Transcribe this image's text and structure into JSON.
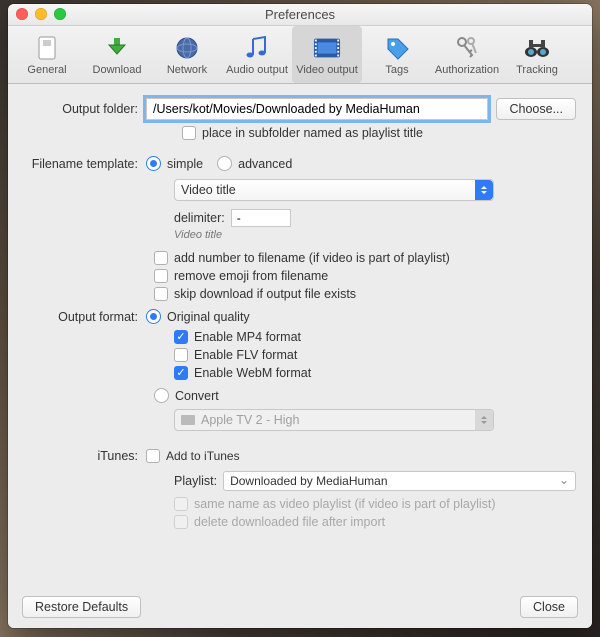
{
  "window": {
    "title": "Preferences"
  },
  "toolbar": {
    "items": [
      {
        "label": "General"
      },
      {
        "label": "Download"
      },
      {
        "label": "Network"
      },
      {
        "label": "Audio output"
      },
      {
        "label": "Video output"
      },
      {
        "label": "Tags"
      },
      {
        "label": "Authorization"
      },
      {
        "label": "Tracking"
      }
    ]
  },
  "labels": {
    "output_folder": "Output folder:",
    "filename_template": "Filename template:",
    "output_format": "Output format:",
    "itunes": "iTunes:",
    "delimiter": "delimiter:",
    "playlist": "Playlist:"
  },
  "values": {
    "output_folder": "/Users/kot/Movies/Downloaded by MediaHuman",
    "filename_select": "Video title",
    "delimiter": "-",
    "filename_preview": "Video title",
    "convert_preset": "Apple TV 2 - High",
    "itunes_playlist": "Downloaded by MediaHuman"
  },
  "buttons": {
    "choose": "Choose...",
    "restore": "Restore Defaults",
    "close": "Close"
  },
  "options": {
    "subfolder": "place in subfolder named as playlist title",
    "tmpl_simple": "simple",
    "tmpl_advanced": "advanced",
    "add_number": "add number to filename (if video is part of playlist)",
    "remove_emoji": "remove emoji from filename",
    "skip_existing": "skip download if output file exists",
    "original_quality": "Original quality",
    "enable_mp4": "Enable MP4 format",
    "enable_flv": "Enable FLV format",
    "enable_webm": "Enable WebM format",
    "convert": "Convert",
    "add_itunes": "Add to iTunes",
    "same_name": "same name as video playlist (if video is part of playlist)",
    "delete_after": "delete downloaded file after import"
  }
}
